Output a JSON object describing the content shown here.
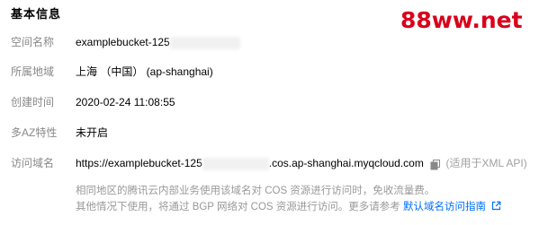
{
  "section": {
    "title": "基本信息"
  },
  "watermark": {
    "text": "88ww.net",
    "color": "#d9001b"
  },
  "fields": {
    "bucket_name": {
      "label": "空间名称",
      "value": "examplebucket-125"
    },
    "region": {
      "label": "所属地域",
      "value": "上海 （中国） (ap-shanghai)"
    },
    "created": {
      "label": "创建时间",
      "value": "2020-02-24 11:08:55"
    },
    "multi_az": {
      "label": "多AZ特性",
      "value": "未开启"
    },
    "domain": {
      "label": "访问域名",
      "value_prefix": "https://examplebucket-125",
      "value_suffix": ".cos.ap-shanghai.myqcloud.com",
      "copy_icon": "copy-icon",
      "hint": "(适用于XML API)"
    }
  },
  "notes": {
    "line1": "相同地区的腾讯云内部业务使用该域名对 COS 资源进行访问时，免收流量费。",
    "line2": "其他情况下使用，将通过 BGP 网络对 COS 资源进行访问。更多请参考",
    "link_text": "默认域名访问指南",
    "link_icon": "external-link-icon",
    "link_color": "#006eff"
  }
}
